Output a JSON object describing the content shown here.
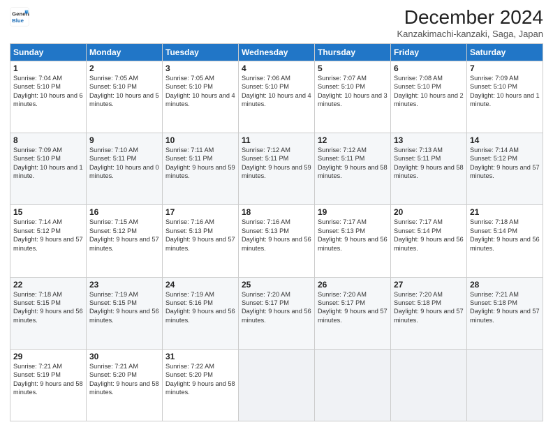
{
  "logo": {
    "line1": "General",
    "line2": "Blue"
  },
  "header": {
    "month": "December 2024",
    "location": "Kanzakimachi-kanzaki, Saga, Japan"
  },
  "weekdays": [
    "Sunday",
    "Monday",
    "Tuesday",
    "Wednesday",
    "Thursday",
    "Friday",
    "Saturday"
  ],
  "weeks": [
    [
      {
        "day": "1",
        "sunrise": "Sunrise: 7:04 AM",
        "sunset": "Sunset: 5:10 PM",
        "daylight": "Daylight: 10 hours and 6 minutes."
      },
      {
        "day": "2",
        "sunrise": "Sunrise: 7:05 AM",
        "sunset": "Sunset: 5:10 PM",
        "daylight": "Daylight: 10 hours and 5 minutes."
      },
      {
        "day": "3",
        "sunrise": "Sunrise: 7:05 AM",
        "sunset": "Sunset: 5:10 PM",
        "daylight": "Daylight: 10 hours and 4 minutes."
      },
      {
        "day": "4",
        "sunrise": "Sunrise: 7:06 AM",
        "sunset": "Sunset: 5:10 PM",
        "daylight": "Daylight: 10 hours and 4 minutes."
      },
      {
        "day": "5",
        "sunrise": "Sunrise: 7:07 AM",
        "sunset": "Sunset: 5:10 PM",
        "daylight": "Daylight: 10 hours and 3 minutes."
      },
      {
        "day": "6",
        "sunrise": "Sunrise: 7:08 AM",
        "sunset": "Sunset: 5:10 PM",
        "daylight": "Daylight: 10 hours and 2 minutes."
      },
      {
        "day": "7",
        "sunrise": "Sunrise: 7:09 AM",
        "sunset": "Sunset: 5:10 PM",
        "daylight": "Daylight: 10 hours and 1 minute."
      }
    ],
    [
      {
        "day": "8",
        "sunrise": "Sunrise: 7:09 AM",
        "sunset": "Sunset: 5:10 PM",
        "daylight": "Daylight: 10 hours and 1 minute."
      },
      {
        "day": "9",
        "sunrise": "Sunrise: 7:10 AM",
        "sunset": "Sunset: 5:11 PM",
        "daylight": "Daylight: 10 hours and 0 minutes."
      },
      {
        "day": "10",
        "sunrise": "Sunrise: 7:11 AM",
        "sunset": "Sunset: 5:11 PM",
        "daylight": "Daylight: 9 hours and 59 minutes."
      },
      {
        "day": "11",
        "sunrise": "Sunrise: 7:12 AM",
        "sunset": "Sunset: 5:11 PM",
        "daylight": "Daylight: 9 hours and 59 minutes."
      },
      {
        "day": "12",
        "sunrise": "Sunrise: 7:12 AM",
        "sunset": "Sunset: 5:11 PM",
        "daylight": "Daylight: 9 hours and 58 minutes."
      },
      {
        "day": "13",
        "sunrise": "Sunrise: 7:13 AM",
        "sunset": "Sunset: 5:11 PM",
        "daylight": "Daylight: 9 hours and 58 minutes."
      },
      {
        "day": "14",
        "sunrise": "Sunrise: 7:14 AM",
        "sunset": "Sunset: 5:12 PM",
        "daylight": "Daylight: 9 hours and 57 minutes."
      }
    ],
    [
      {
        "day": "15",
        "sunrise": "Sunrise: 7:14 AM",
        "sunset": "Sunset: 5:12 PM",
        "daylight": "Daylight: 9 hours and 57 minutes."
      },
      {
        "day": "16",
        "sunrise": "Sunrise: 7:15 AM",
        "sunset": "Sunset: 5:12 PM",
        "daylight": "Daylight: 9 hours and 57 minutes."
      },
      {
        "day": "17",
        "sunrise": "Sunrise: 7:16 AM",
        "sunset": "Sunset: 5:13 PM",
        "daylight": "Daylight: 9 hours and 57 minutes."
      },
      {
        "day": "18",
        "sunrise": "Sunrise: 7:16 AM",
        "sunset": "Sunset: 5:13 PM",
        "daylight": "Daylight: 9 hours and 56 minutes."
      },
      {
        "day": "19",
        "sunrise": "Sunrise: 7:17 AM",
        "sunset": "Sunset: 5:13 PM",
        "daylight": "Daylight: 9 hours and 56 minutes."
      },
      {
        "day": "20",
        "sunrise": "Sunrise: 7:17 AM",
        "sunset": "Sunset: 5:14 PM",
        "daylight": "Daylight: 9 hours and 56 minutes."
      },
      {
        "day": "21",
        "sunrise": "Sunrise: 7:18 AM",
        "sunset": "Sunset: 5:14 PM",
        "daylight": "Daylight: 9 hours and 56 minutes."
      }
    ],
    [
      {
        "day": "22",
        "sunrise": "Sunrise: 7:18 AM",
        "sunset": "Sunset: 5:15 PM",
        "daylight": "Daylight: 9 hours and 56 minutes."
      },
      {
        "day": "23",
        "sunrise": "Sunrise: 7:19 AM",
        "sunset": "Sunset: 5:15 PM",
        "daylight": "Daylight: 9 hours and 56 minutes."
      },
      {
        "day": "24",
        "sunrise": "Sunrise: 7:19 AM",
        "sunset": "Sunset: 5:16 PM",
        "daylight": "Daylight: 9 hours and 56 minutes."
      },
      {
        "day": "25",
        "sunrise": "Sunrise: 7:20 AM",
        "sunset": "Sunset: 5:17 PM",
        "daylight": "Daylight: 9 hours and 56 minutes."
      },
      {
        "day": "26",
        "sunrise": "Sunrise: 7:20 AM",
        "sunset": "Sunset: 5:17 PM",
        "daylight": "Daylight: 9 hours and 57 minutes."
      },
      {
        "day": "27",
        "sunrise": "Sunrise: 7:20 AM",
        "sunset": "Sunset: 5:18 PM",
        "daylight": "Daylight: 9 hours and 57 minutes."
      },
      {
        "day": "28",
        "sunrise": "Sunrise: 7:21 AM",
        "sunset": "Sunset: 5:18 PM",
        "daylight": "Daylight: 9 hours and 57 minutes."
      }
    ],
    [
      {
        "day": "29",
        "sunrise": "Sunrise: 7:21 AM",
        "sunset": "Sunset: 5:19 PM",
        "daylight": "Daylight: 9 hours and 58 minutes."
      },
      {
        "day": "30",
        "sunrise": "Sunrise: 7:21 AM",
        "sunset": "Sunset: 5:20 PM",
        "daylight": "Daylight: 9 hours and 58 minutes."
      },
      {
        "day": "31",
        "sunrise": "Sunrise: 7:22 AM",
        "sunset": "Sunset: 5:20 PM",
        "daylight": "Daylight: 9 hours and 58 minutes."
      },
      null,
      null,
      null,
      null
    ]
  ]
}
